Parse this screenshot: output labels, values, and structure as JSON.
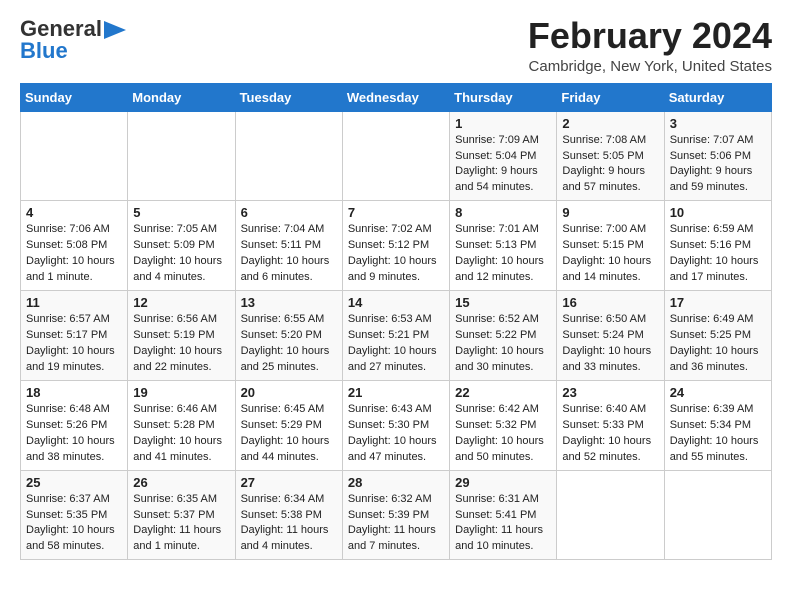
{
  "header": {
    "logo_line1": "General",
    "logo_line2": "Blue",
    "title": "February 2024",
    "subtitle": "Cambridge, New York, United States"
  },
  "days_of_week": [
    "Sunday",
    "Monday",
    "Tuesday",
    "Wednesday",
    "Thursday",
    "Friday",
    "Saturday"
  ],
  "weeks": [
    [
      {
        "day": "",
        "text": ""
      },
      {
        "day": "",
        "text": ""
      },
      {
        "day": "",
        "text": ""
      },
      {
        "day": "",
        "text": ""
      },
      {
        "day": "1",
        "text": "Sunrise: 7:09 AM\nSunset: 5:04 PM\nDaylight: 9 hours\nand 54 minutes."
      },
      {
        "day": "2",
        "text": "Sunrise: 7:08 AM\nSunset: 5:05 PM\nDaylight: 9 hours\nand 57 minutes."
      },
      {
        "day": "3",
        "text": "Sunrise: 7:07 AM\nSunset: 5:06 PM\nDaylight: 9 hours\nand 59 minutes."
      }
    ],
    [
      {
        "day": "4",
        "text": "Sunrise: 7:06 AM\nSunset: 5:08 PM\nDaylight: 10 hours\nand 1 minute."
      },
      {
        "day": "5",
        "text": "Sunrise: 7:05 AM\nSunset: 5:09 PM\nDaylight: 10 hours\nand 4 minutes."
      },
      {
        "day": "6",
        "text": "Sunrise: 7:04 AM\nSunset: 5:11 PM\nDaylight: 10 hours\nand 6 minutes."
      },
      {
        "day": "7",
        "text": "Sunrise: 7:02 AM\nSunset: 5:12 PM\nDaylight: 10 hours\nand 9 minutes."
      },
      {
        "day": "8",
        "text": "Sunrise: 7:01 AM\nSunset: 5:13 PM\nDaylight: 10 hours\nand 12 minutes."
      },
      {
        "day": "9",
        "text": "Sunrise: 7:00 AM\nSunset: 5:15 PM\nDaylight: 10 hours\nand 14 minutes."
      },
      {
        "day": "10",
        "text": "Sunrise: 6:59 AM\nSunset: 5:16 PM\nDaylight: 10 hours\nand 17 minutes."
      }
    ],
    [
      {
        "day": "11",
        "text": "Sunrise: 6:57 AM\nSunset: 5:17 PM\nDaylight: 10 hours\nand 19 minutes."
      },
      {
        "day": "12",
        "text": "Sunrise: 6:56 AM\nSunset: 5:19 PM\nDaylight: 10 hours\nand 22 minutes."
      },
      {
        "day": "13",
        "text": "Sunrise: 6:55 AM\nSunset: 5:20 PM\nDaylight: 10 hours\nand 25 minutes."
      },
      {
        "day": "14",
        "text": "Sunrise: 6:53 AM\nSunset: 5:21 PM\nDaylight: 10 hours\nand 27 minutes."
      },
      {
        "day": "15",
        "text": "Sunrise: 6:52 AM\nSunset: 5:22 PM\nDaylight: 10 hours\nand 30 minutes."
      },
      {
        "day": "16",
        "text": "Sunrise: 6:50 AM\nSunset: 5:24 PM\nDaylight: 10 hours\nand 33 minutes."
      },
      {
        "day": "17",
        "text": "Sunrise: 6:49 AM\nSunset: 5:25 PM\nDaylight: 10 hours\nand 36 minutes."
      }
    ],
    [
      {
        "day": "18",
        "text": "Sunrise: 6:48 AM\nSunset: 5:26 PM\nDaylight: 10 hours\nand 38 minutes."
      },
      {
        "day": "19",
        "text": "Sunrise: 6:46 AM\nSunset: 5:28 PM\nDaylight: 10 hours\nand 41 minutes."
      },
      {
        "day": "20",
        "text": "Sunrise: 6:45 AM\nSunset: 5:29 PM\nDaylight: 10 hours\nand 44 minutes."
      },
      {
        "day": "21",
        "text": "Sunrise: 6:43 AM\nSunset: 5:30 PM\nDaylight: 10 hours\nand 47 minutes."
      },
      {
        "day": "22",
        "text": "Sunrise: 6:42 AM\nSunset: 5:32 PM\nDaylight: 10 hours\nand 50 minutes."
      },
      {
        "day": "23",
        "text": "Sunrise: 6:40 AM\nSunset: 5:33 PM\nDaylight: 10 hours\nand 52 minutes."
      },
      {
        "day": "24",
        "text": "Sunrise: 6:39 AM\nSunset: 5:34 PM\nDaylight: 10 hours\nand 55 minutes."
      }
    ],
    [
      {
        "day": "25",
        "text": "Sunrise: 6:37 AM\nSunset: 5:35 PM\nDaylight: 10 hours\nand 58 minutes."
      },
      {
        "day": "26",
        "text": "Sunrise: 6:35 AM\nSunset: 5:37 PM\nDaylight: 11 hours\nand 1 minute."
      },
      {
        "day": "27",
        "text": "Sunrise: 6:34 AM\nSunset: 5:38 PM\nDaylight: 11 hours\nand 4 minutes."
      },
      {
        "day": "28",
        "text": "Sunrise: 6:32 AM\nSunset: 5:39 PM\nDaylight: 11 hours\nand 7 minutes."
      },
      {
        "day": "29",
        "text": "Sunrise: 6:31 AM\nSunset: 5:41 PM\nDaylight: 11 hours\nand 10 minutes."
      },
      {
        "day": "",
        "text": ""
      },
      {
        "day": "",
        "text": ""
      }
    ]
  ]
}
